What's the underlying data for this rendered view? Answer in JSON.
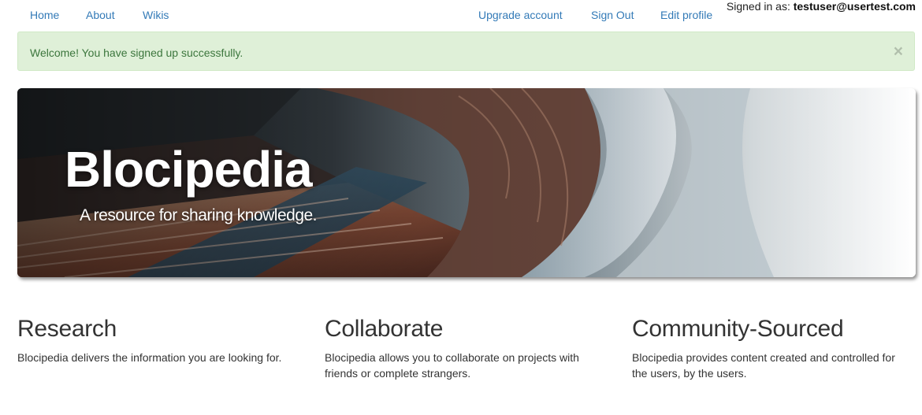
{
  "nav": {
    "links": [
      {
        "label": "Home"
      },
      {
        "label": "About"
      },
      {
        "label": "Wikis"
      }
    ],
    "right_links": [
      {
        "label": "Upgrade account"
      },
      {
        "label": "Sign Out"
      },
      {
        "label": "Edit profile"
      }
    ],
    "signed_in_prefix": "Signed in as:",
    "signed_in_user": "testuser@usertest.com"
  },
  "alert": {
    "message": "Welcome! You have signed up successfully.",
    "close_glyph": "×",
    "color": "#dff0d8"
  },
  "hero": {
    "title": "Blocipedia",
    "subtitle": "A resource for sharing knowledge."
  },
  "features": [
    {
      "title": "Research",
      "text": "Blocipedia delivers the information you are looking for."
    },
    {
      "title": "Collaborate",
      "text": "Blocipedia allows you to collaborate on projects with friends or complete strangers."
    },
    {
      "title": "Community-Sourced",
      "text": "Blocipedia provides content created and controlled for the users, by the users."
    }
  ],
  "colors": {
    "link": "#337ab7",
    "text": "#333333",
    "alert_text": "#3c763d"
  }
}
